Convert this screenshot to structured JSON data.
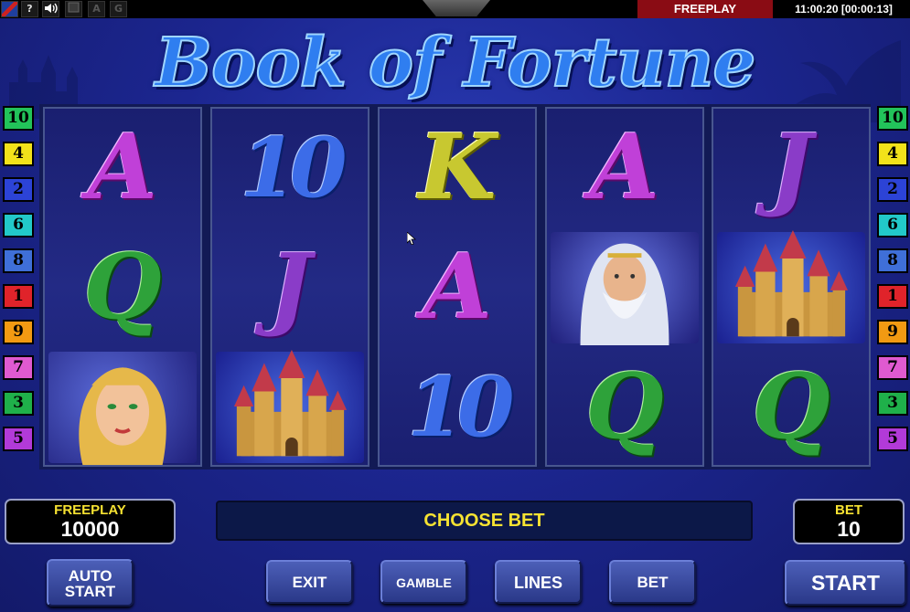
{
  "topbar": {
    "help_label": "?",
    "sound_icon": "speaker-icon",
    "btn_a_label": "A",
    "btn_g_label": "G",
    "mode": "FREEPLAY",
    "clock": "11:00:20 [00:00:13]"
  },
  "title": "Book of Fortune",
  "markers_left": [
    {
      "num": "10",
      "color": "#22c35a"
    },
    {
      "num": "4",
      "color": "#f2e21a"
    },
    {
      "num": "2",
      "color": "#2c43d6"
    },
    {
      "num": "6",
      "color": "#22c9c9"
    },
    {
      "num": "8",
      "color": "#3f6fd8"
    },
    {
      "num": "1",
      "color": "#e0232a"
    },
    {
      "num": "9",
      "color": "#f29a12"
    },
    {
      "num": "7",
      "color": "#e05ad0"
    },
    {
      "num": "3",
      "color": "#1fb04a"
    },
    {
      "num": "5",
      "color": "#b23ad8"
    }
  ],
  "markers_right": [
    {
      "num": "10",
      "color": "#22c35a"
    },
    {
      "num": "4",
      "color": "#f2e21a"
    },
    {
      "num": "2",
      "color": "#2c43d6"
    },
    {
      "num": "6",
      "color": "#22c9c9"
    },
    {
      "num": "8",
      "color": "#3f6fd8"
    },
    {
      "num": "1",
      "color": "#e0232a"
    },
    {
      "num": "9",
      "color": "#f29a12"
    },
    {
      "num": "7",
      "color": "#e05ad0"
    },
    {
      "num": "3",
      "color": "#1fb04a"
    },
    {
      "num": "5",
      "color": "#b23ad8"
    }
  ],
  "reels": [
    [
      "A",
      "Q",
      "woman-portrait"
    ],
    [
      "10",
      "J",
      "castle"
    ],
    [
      "K",
      "A",
      "10"
    ],
    [
      "A",
      "wizard-portrait",
      "Q"
    ],
    [
      "J",
      "castle",
      "Q"
    ]
  ],
  "credit": {
    "label": "FREEPLAY",
    "value": "10000"
  },
  "bet": {
    "label": "BET",
    "value": "10"
  },
  "message": "CHOOSE BET",
  "buttons": {
    "auto_line1": "AUTO",
    "auto_line2": "START",
    "exit": "EXIT",
    "gamble": "GAMBLE",
    "lines": "LINES",
    "bet": "BET",
    "start": "START"
  }
}
